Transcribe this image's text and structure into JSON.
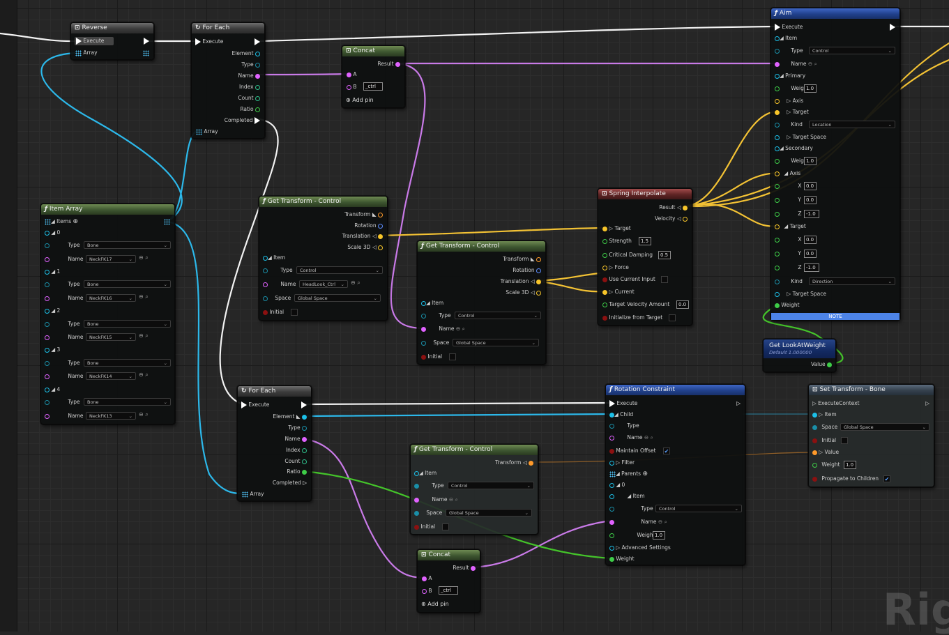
{
  "colors": {
    "exec": "#ffffff",
    "name_pin": "#e062ff",
    "transform_pin": "#ff9a2a",
    "vector_pin": "#f7c52a",
    "float_pin": "#3ecc48",
    "struct_pin": "#1cc0e8",
    "bool_pin": "#8b1111",
    "wire_exec": "#f2f2f2",
    "wire_item": "#2cb8ea",
    "wire_name": "#c97ae8",
    "wire_vector": "#f3c234",
    "wire_float": "#44c42a",
    "wire_transform": "#e08a2a",
    "note": "#4d84e8"
  },
  "watermark": "Rig",
  "nodes": {
    "reverse": {
      "title": "Reverse",
      "execute": "Execute",
      "array": "Array"
    },
    "foreach_top": {
      "title": "For Each",
      "execute": "Execute",
      "element": "Element",
      "type": "Type",
      "name": "Name",
      "index": "Index",
      "count": "Count",
      "ratio": "Ratio",
      "completed": "Completed",
      "array": "Array"
    },
    "concat_top": {
      "title": "Concat",
      "result": "Result",
      "a": "A",
      "b": "B",
      "b_value": "_ctrl",
      "add_pin": "Add pin"
    },
    "item_array": {
      "title": "Item Array",
      "items_label": "Items",
      "items": [
        {
          "index": "0",
          "type": "Bone",
          "name": "NeckFK17"
        },
        {
          "index": "1",
          "type": "Bone",
          "name": "NeckFK16"
        },
        {
          "index": "2",
          "type": "Bone",
          "name": "NeckFK15"
        },
        {
          "index": "3",
          "type": "Bone",
          "name": "NeckFK14"
        },
        {
          "index": "4",
          "type": "Bone",
          "name": "NeckFK13"
        }
      ],
      "type_label": "Type",
      "name_label": "Name"
    },
    "get_transform_a": {
      "title": "Get Transform - Control",
      "transform": "Transform",
      "rotation": "Rotation",
      "translation": "Translation",
      "scale": "Scale 3D",
      "item": "Item",
      "type": "Type",
      "type_value": "Control",
      "name": "Name",
      "name_value": "HeadLook_Ctrl",
      "space": "Space",
      "space_value": "Global Space",
      "initial": "Initial"
    },
    "get_transform_b": {
      "title": "Get Transform - Control",
      "transform": "Transform",
      "rotation": "Rotation",
      "translation": "Translation",
      "scale": "Scale 3D",
      "item": "Item",
      "type": "Type",
      "type_value": "Control",
      "name": "Name",
      "space": "Space",
      "space_value": "Global Space",
      "initial": "Initial"
    },
    "spring": {
      "title": "Spring Interpolate",
      "result": "Result",
      "velocity": "Velocity",
      "target": "Target",
      "strength": "Strength",
      "strength_value": "1.5",
      "damping": "Critical Damping",
      "damping_value": "0.5",
      "force": "Force",
      "use_current": "Use Current Input",
      "current": "Current",
      "tva": "Target Velocity Amount",
      "tva_value": "0.0",
      "init": "Initialize from Target"
    },
    "aim": {
      "title": "Aim",
      "execute": "Execute",
      "item": "Item",
      "type": "Type",
      "type_value": "Control",
      "name": "Name",
      "primary": "Primary",
      "weight": "Weight",
      "primary_weight": "1.0",
      "axis": "Axis",
      "target": "Target",
      "kind": "Kind",
      "primary_kind": "Location",
      "target_space": "Target Space",
      "secondary": "Secondary",
      "secondary_weight": "1.0",
      "x": "X",
      "y": "Y",
      "z": "Z",
      "axis_x": "0.0",
      "axis_y": "0.0",
      "axis_z": "-1.0",
      "target_x": "0.0",
      "target_y": "0.0",
      "target_z": "-1.0",
      "secondary_kind": "Direction",
      "weight_bottom": "Weight",
      "note": "NOTE"
    },
    "get_lookat": {
      "title": "Get LookAtWeight",
      "default": "Default 1.000000",
      "value": "Value"
    },
    "foreach_bottom": {
      "title": "For Each",
      "execute": "Execute",
      "element": "Element",
      "type": "Type",
      "name": "Name",
      "index": "Index",
      "count": "Count",
      "ratio": "Ratio",
      "completed": "Completed",
      "array": "Array"
    },
    "get_transform_c": {
      "title": "Get Transform - Control",
      "transform": "Transform",
      "item": "Item",
      "type": "Type",
      "type_value": "Control",
      "name": "Name",
      "space": "Space",
      "space_value": "Global Space",
      "initial": "Initial"
    },
    "concat_bottom": {
      "title": "Concat",
      "result": "Result",
      "a": "A",
      "b": "B",
      "b_value": "_ctrl",
      "add_pin": "Add pin"
    },
    "rotation_constraint": {
      "title": "Rotation Constraint",
      "execute": "Execute",
      "child": "Child",
      "type": "Type",
      "name": "Name",
      "maintain": "Maintain Offset",
      "filter": "Filter",
      "parents": "Parents",
      "p0": "0",
      "item": "Item",
      "type_value": "Control",
      "weight": "Weight",
      "weight_value": "1.0",
      "advanced": "Advanced Settings",
      "weight_bottom": "Weight"
    },
    "set_transform": {
      "title": "Set Transform - Bone",
      "exec_ctx": "ExecuteContext",
      "item": "Item",
      "space": "Space",
      "space_value": "Global Space",
      "initial": "Initial",
      "value": "Value",
      "weight": "Weight",
      "weight_value": "1.0",
      "propagate": "Propagate to Children"
    }
  }
}
